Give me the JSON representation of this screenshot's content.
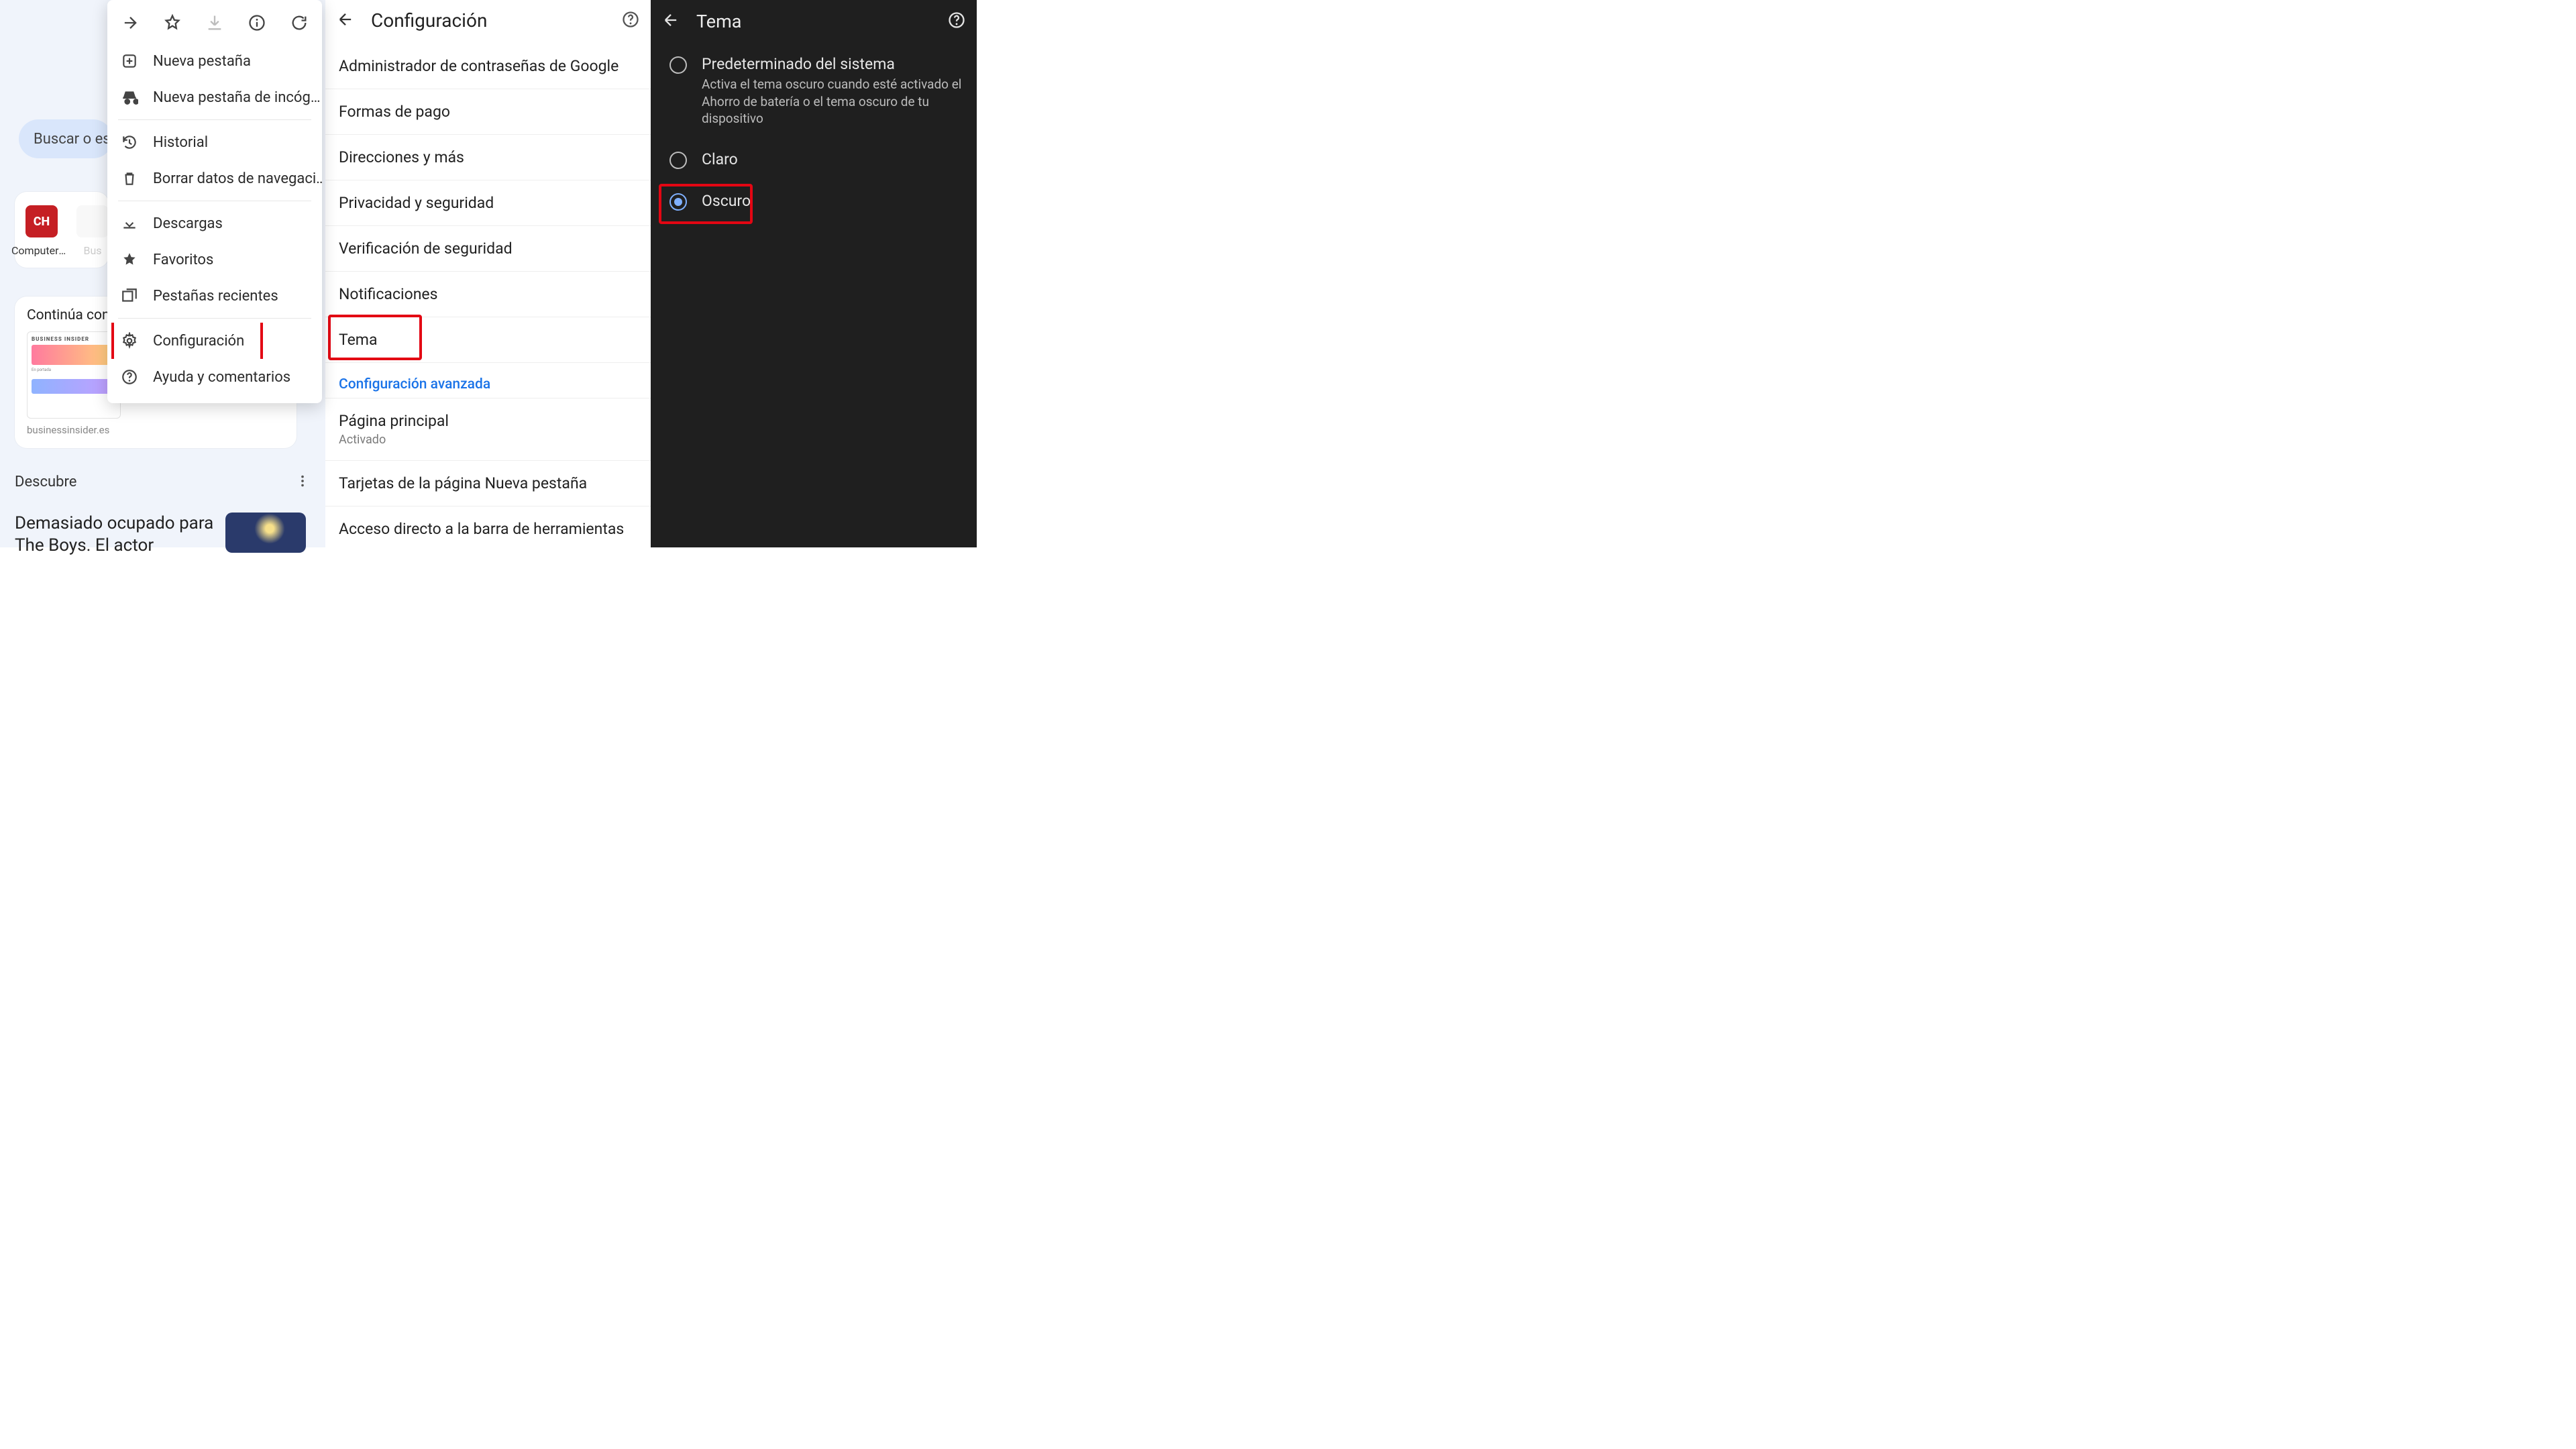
{
  "panel1": {
    "search_placeholder": "Buscar o es",
    "shortcut_labels": [
      "ComputerH…",
      "Bus"
    ],
    "continue_title": "Continúa con",
    "thumb_brand": "BUSINESS INSIDER",
    "thumb_subtitle": "businessinsider.es",
    "discover": "Descubre",
    "article_title": "Demasiado ocupado para The Boys. El actor"
  },
  "menu": {
    "items": [
      "Nueva pestaña",
      "Nueva pestaña de incóg…",
      "Historial",
      "Borrar datos de navegaci…",
      "Descargas",
      "Favoritos",
      "Pestañas recientes",
      "Configuración",
      "Ayuda y comentarios"
    ]
  },
  "panel2": {
    "title": "Configuración",
    "items": [
      "Administrador de contraseñas de Google",
      "Formas de pago",
      "Direcciones y más",
      "Privacidad y seguridad",
      "Verificación de seguridad",
      "Notificaciones",
      "Tema"
    ],
    "section": "Configuración avanzada",
    "homepage_label": "Página principal",
    "homepage_sub": "Activado",
    "items2": [
      "Tarjetas de la página Nueva pestaña",
      "Acceso directo a la barra de herramientas"
    ]
  },
  "panel3": {
    "title": "Tema",
    "options": [
      {
        "label": "Predeterminado del sistema",
        "desc": "Activa el tema oscuro cuando esté activado el Ahorro de batería o el tema oscuro de tu dispositivo",
        "checked": false
      },
      {
        "label": "Claro",
        "desc": "",
        "checked": false
      },
      {
        "label": "Oscuro",
        "desc": "",
        "checked": true
      }
    ]
  }
}
